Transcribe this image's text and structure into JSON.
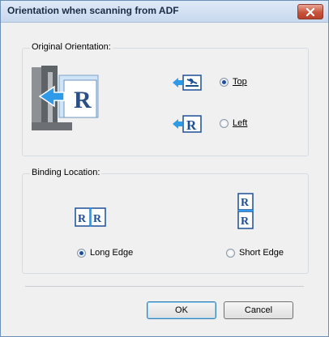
{
  "window": {
    "title": "Orientation when scanning from ADF"
  },
  "orientation": {
    "group_label": "Original Orientation:",
    "options": [
      {
        "label": "Top",
        "selected": true
      },
      {
        "label": "Left",
        "selected": false
      }
    ]
  },
  "binding": {
    "group_label": "Binding Location:",
    "options": [
      {
        "label": "Long Edge",
        "selected": true
      },
      {
        "label": "Short Edge",
        "selected": false
      }
    ]
  },
  "buttons": {
    "ok": "OK",
    "cancel": "Cancel"
  },
  "colors": {
    "accent": "#1f6fc6",
    "title_bg": "#c7d8ee",
    "close": "#c8543c"
  }
}
